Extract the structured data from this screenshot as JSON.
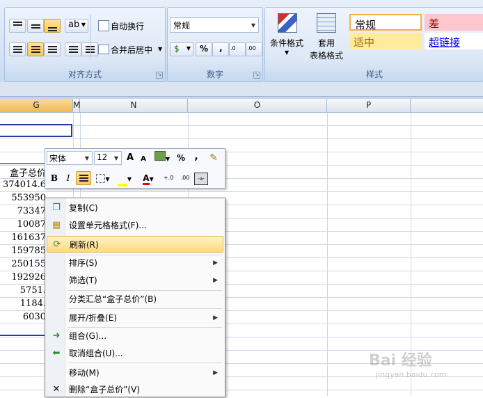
{
  "ribbon": {
    "alignment_group_label": "对齐方式",
    "number_group_label": "数字",
    "styles_group_label": "样式",
    "wrap_text_label": "自动换行",
    "merge_center_label": "合并后居中",
    "number_format_value": "常规",
    "currency_symbol": "$",
    "percent_symbol": "%",
    "comma_symbol": ",",
    "increase_decimal": "←.0 .00",
    "decrease_decimal": ".00 →.0",
    "conditional_format_label": "条件格式",
    "format_table_label1": "套用",
    "format_table_label2": "表格格式",
    "style_normal": "常规",
    "style_bad": "差",
    "style_neutral": "适中",
    "style_hyperlink": "超链接"
  },
  "columns": [
    "G",
    "M",
    "N",
    "O",
    "P"
  ],
  "cells": {
    "header": "盒子总价",
    "values": [
      "374014.6",
      "553950",
      "73347",
      "10087",
      "161637",
      "159785",
      "250155",
      "192926",
      "5751.",
      "1184.",
      "6030"
    ]
  },
  "mini_toolbar": {
    "font_name": "宋体",
    "font_size": "12",
    "grow_font": "A",
    "shrink_font": "A",
    "percent": "%",
    "comma": ",",
    "bold": "B",
    "italic": "I",
    "font_color_letter": "A"
  },
  "context_menu": {
    "items": [
      {
        "label": "复制(C)",
        "icon": "copy-icon"
      },
      {
        "label": "设置单元格格式(F)...",
        "icon": "format-cells-icon"
      },
      {
        "label": "刷新(R)",
        "icon": "refresh-icon"
      },
      {
        "label": "排序(S)",
        "icon": ""
      },
      {
        "label": "筛选(T)",
        "icon": ""
      },
      {
        "label": "分类汇总“盒子总价”(B)",
        "icon": ""
      },
      {
        "label": "展开/折叠(E)",
        "icon": ""
      },
      {
        "label": "组合(G)...",
        "icon": "group-arrow-icon"
      },
      {
        "label": "取消组合(U)...",
        "icon": "ungroup-arrow-icon"
      },
      {
        "label": "移动(M)",
        "icon": ""
      },
      {
        "label": "删除“盒子总价”(V)",
        "icon": "delete-x-icon"
      }
    ]
  },
  "watermark": {
    "brand": "Bai 经验",
    "url": "jingyan.baidu.com"
  }
}
